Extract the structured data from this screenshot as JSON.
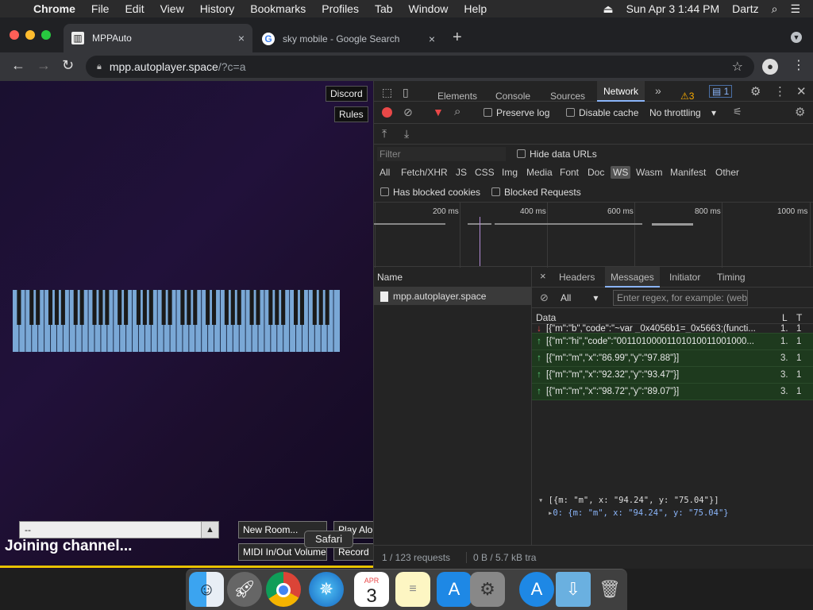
{
  "menubar": {
    "app": "Chrome",
    "items": [
      "File",
      "Edit",
      "View",
      "History",
      "Bookmarks",
      "Profiles",
      "Tab",
      "Window",
      "Help"
    ],
    "datetime": "Sun Apr 3  1:44 PM",
    "user": "Dartz"
  },
  "tabs": [
    {
      "title": "MPPAuto",
      "close": "×"
    },
    {
      "title": "sky mobile - Google Search",
      "close": "×"
    }
  ],
  "toolbar": {
    "url_host": "mpp.autoplayer.space",
    "url_path": "/?c=a"
  },
  "page": {
    "discord_label": "Discord",
    "rules_label": "Rules",
    "channel_value": "--",
    "joining_text": "Joining channel...",
    "new_room_label": "New Room...",
    "play_alone_label": "Play Alo",
    "midi_label": "MIDI In/Out",
    "volume_label": "Volume",
    "record_label": "Record"
  },
  "devtools": {
    "tabs": [
      "Elements",
      "Console",
      "Sources",
      "Network"
    ],
    "more": "»",
    "warnings": "3",
    "messages_count": "1",
    "preserve_log": "Preserve log",
    "disable_cache": "Disable cache",
    "throttling": "No throttling",
    "filter_placeholder": "Filter",
    "hide_data_urls": "Hide data URLs",
    "types": [
      "All",
      "Fetch/XHR",
      "JS",
      "CSS",
      "Img",
      "Media",
      "Font",
      "Doc",
      "WS",
      "Wasm",
      "Manifest",
      "Other"
    ],
    "has_blocked_cookies": "Has blocked cookies",
    "blocked_requests": "Blocked Requests",
    "timeline_ticks": [
      "200 ms",
      "400 ms",
      "600 ms",
      "800 ms",
      "1000 ms"
    ],
    "name_header": "Name",
    "request_name": "mpp.autoplayer.space",
    "detail_tabs": [
      "Headers",
      "Messages",
      "Initiator",
      "Timing"
    ],
    "detail_close": "×",
    "msg_filter": "All",
    "msg_regex_placeholder": "Enter regex, for example: (web",
    "table_headers": [
      "Data",
      "L",
      "T"
    ],
    "messages": [
      {
        "dir": "down",
        "data": "[{\"m\":\"b\",\"code\":\"~var _0x4056b1=_0x5663;(functi...",
        "l": "1.",
        "t": "1"
      },
      {
        "dir": "up",
        "data": "[{\"m\":\"hi\",\"code\":\"00110100001101010011001000...",
        "l": "1.",
        "t": "1"
      },
      {
        "dir": "up",
        "data": "[{\"m\":\"m\",\"x\":\"86.99\",\"y\":\"97.88\"}]",
        "l": "3.",
        "t": "1"
      },
      {
        "dir": "up",
        "data": "[{\"m\":\"m\",\"x\":\"92.32\",\"y\":\"93.47\"}]",
        "l": "3.",
        "t": "1"
      },
      {
        "dir": "up",
        "data": "[{\"m\":\"m\",\"x\":\"98.72\",\"y\":\"89.07\"}]",
        "l": "3.",
        "t": "1"
      }
    ],
    "json_root": "[{m: \"m\", x: \"94.24\", y: \"75.04\"}]",
    "json_child": "0: {m: \"m\", x: \"94.24\", y: \"75.04\"}",
    "status_requests": "1 / 123 requests",
    "status_transferred": "0 B / 5.7 kB tra"
  },
  "dock": {
    "tooltip": "Safari",
    "calendar_month": "APR",
    "calendar_day": "3"
  },
  "colors": {
    "devtools_bg": "#242424",
    "message_bg": "#1e3a1e",
    "accent_blue": "#8ab4f8",
    "record_red": "#e94848"
  }
}
